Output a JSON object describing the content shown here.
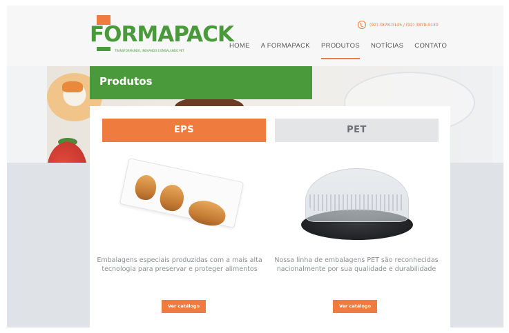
{
  "brand": {
    "name": "FORMAPACK",
    "tagline": "TRANSFORMANDO, INOVANDO E EMBALANDO PET",
    "color_green": "#4a9a3c",
    "color_orange": "#ef7b3e"
  },
  "header": {
    "phones": "(92) 3878-0145 / (92) 3878-0130",
    "nav": [
      {
        "label": "HOME",
        "active": false
      },
      {
        "label": "A FORMAPACK",
        "active": false
      },
      {
        "label": "PRODUTOS",
        "active": true
      },
      {
        "label": "NOTÍCIAS",
        "active": false
      },
      {
        "label": "CONTATO",
        "active": false
      }
    ]
  },
  "section": {
    "title": "Produtos"
  },
  "products": {
    "tabs": [
      {
        "label": "EPS",
        "active": true
      },
      {
        "label": "PET",
        "active": false
      }
    ],
    "eps": {
      "description": "Embalagens especiais produzidas com a mais alta tecnologia para preservar e proteger alimentos",
      "button": "Ver catálogo"
    },
    "pet": {
      "description": "Nossa linha de embalagens PET são reconhecidas nacionalmente por sua qualidade e durabilidade",
      "button": "Ver catálogo"
    }
  }
}
